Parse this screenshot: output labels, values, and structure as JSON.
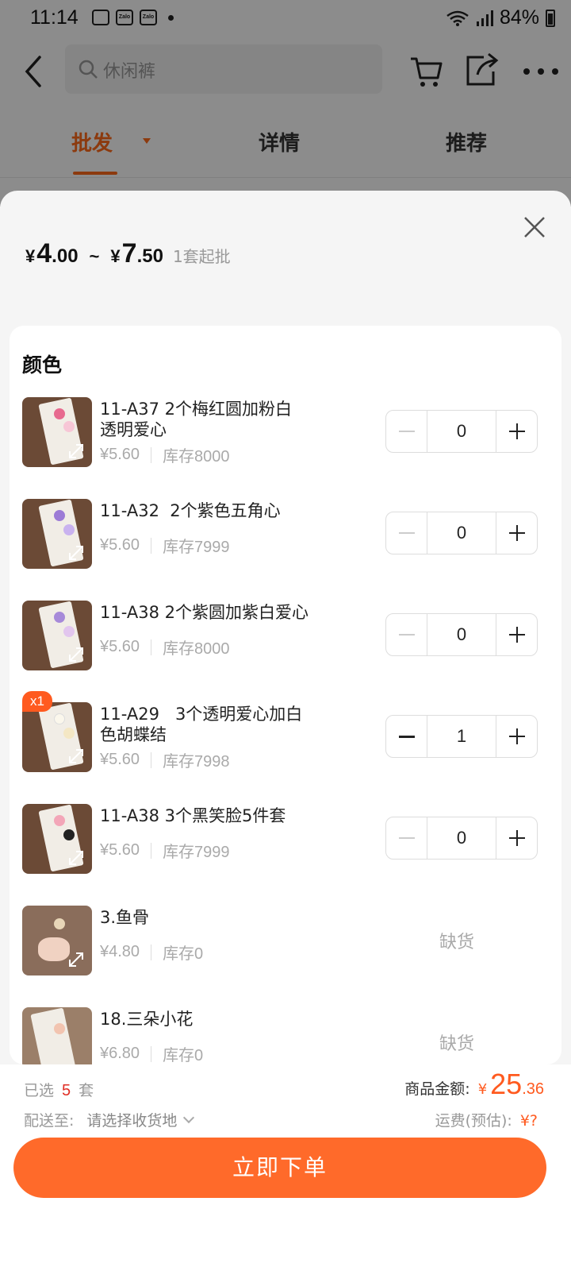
{
  "status_bar": {
    "time": "11:14",
    "battery": "84%",
    "notif1": "Zalo",
    "notif2": "Zalo"
  },
  "search": {
    "placeholder": "休闲裤"
  },
  "tabs": [
    {
      "label": "批发",
      "active": true
    },
    {
      "label": "详情",
      "active": false
    },
    {
      "label": "推荐",
      "active": false
    }
  ],
  "sheet": {
    "price_min": {
      "yen": "¥",
      "int": "4",
      "dec": ".00"
    },
    "tilde": "~",
    "price_max": {
      "yen": "¥",
      "int": "7",
      "dec": ".50"
    },
    "min_order": "1套起批",
    "section_title": "颜色",
    "items": [
      {
        "name": "11-A37 2个梅红圆加粉白\n透明爱心",
        "price": "¥5.60",
        "stock": "库存8000",
        "qty": "0",
        "badge": ""
      },
      {
        "name": "11-A32  2个紫色五角心",
        "price": "¥5.60",
        "stock": "库存7999",
        "qty": "0",
        "badge": ""
      },
      {
        "name": "11-A38 2个紫圆加紫白爱心",
        "price": "¥5.60",
        "stock": "库存8000",
        "qty": "0",
        "badge": ""
      },
      {
        "name": "11-A29   3个透明爱心加白\n色胡蝶结",
        "price": "¥5.60",
        "stock": "库存7998",
        "qty": "1",
        "badge": "x1"
      },
      {
        "name": "11-A38 3个黑笑脸5件套",
        "price": "¥5.60",
        "stock": "库存7999",
        "qty": "0",
        "badge": ""
      },
      {
        "name": "3.鱼骨",
        "price": "¥4.80",
        "stock": "库存0",
        "status": "缺货"
      },
      {
        "name": "18.三朵小花",
        "price": "¥6.80",
        "stock": "库存0",
        "status": "缺货"
      }
    ]
  },
  "bottom": {
    "selected_label": "已选",
    "selected_count": "5",
    "selected_unit": "套",
    "amount_label": "商品金额:",
    "amount_yen": "¥",
    "amount_int": "25",
    "amount_dec": ".36",
    "ship_label": "配送至:",
    "ship_value": "请选择收货地",
    "freight_label": "运费(预估):",
    "freight_value": "¥?",
    "order_button": "立即下单"
  },
  "colors": {
    "accent": "#ff6a2a",
    "price": "#ff5a1f",
    "count": "#e02e24"
  }
}
